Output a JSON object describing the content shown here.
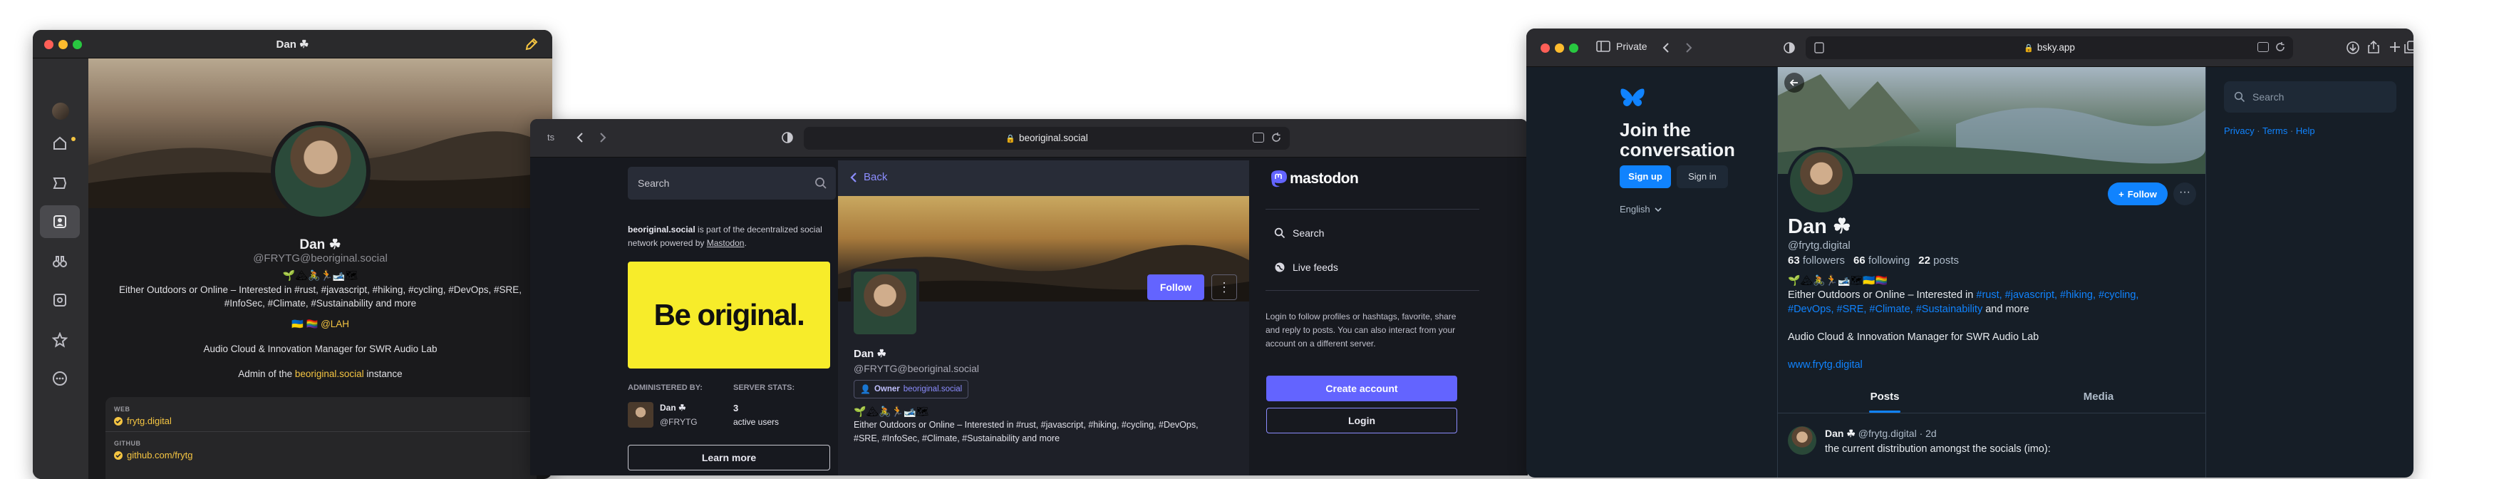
{
  "ivory": {
    "title": "Dan ☘",
    "display_name": "Dan ☘",
    "handle": "@FRYTG@beoriginal.social",
    "bio_emoji": "🌱🏔🚴🏃🎿🗺",
    "bio_line1": "Either Outdoors or Online – Interested in #rust, #javascript, #hiking, #cycling, #DevOps, #SRE,",
    "bio_line2": "#InfoSec, #Climate, #Sustainability and more",
    "bio_flags": "🇺🇦 🏳️‍🌈 @LAH",
    "bio_job": "Audio Cloud & Innovation Manager for SWR Audio Lab",
    "admin_prefix": "Admin of the ",
    "admin_link": "beoriginal.social",
    "admin_suffix": " instance",
    "fields": [
      {
        "label": "WEB",
        "value": "frytg.digital"
      },
      {
        "label": "GITHUB",
        "value": "github.com/frytg"
      }
    ]
  },
  "mastodon": {
    "toolbar_left_text": "ts",
    "url": "beoriginal.social",
    "search_placeholder": "Search",
    "about_strong": "beoriginal.social",
    "about_text": " is part of the decentralized social network powered by ",
    "about_link": "Mastodon",
    "about_end": ".",
    "banner_text": "Be original.",
    "administered_by_label": "ADMINISTERED BY:",
    "server_stats_label": "SERVER STATS:",
    "admin_name": "Dan ☘",
    "admin_handle": "@FRYTG",
    "active_users_count": "3",
    "active_users_label": "active users",
    "learn_more": "Learn more",
    "back_label": "Back",
    "follow_label": "Follow",
    "more_label": "⋮",
    "profile_name": "Dan ☘",
    "profile_handle": "@FRYTG@beoriginal.social",
    "owner_badge": "Owner",
    "owner_badge_domain": "beoriginal.social",
    "bio_emoji": "🌱🏔🚴🏃🎿🗺",
    "bio_line1": "Either Outdoors or Online – Interested in #rust, #javascript, #hiking, #cycling, #DevOps,",
    "bio_line2": "#SRE, #InfoSec, #Climate, #Sustainability and more",
    "logo_text": "mastodon",
    "nav": [
      {
        "icon": "search-icon",
        "label": "Search"
      },
      {
        "icon": "globe-icon",
        "label": "Live feeds"
      }
    ],
    "signup_prompt": "Login to follow profiles or hashtags, favorite, share and reply to posts. You can also interact from your account on a different server.",
    "create_account": "Create account",
    "login": "Login"
  },
  "bluesky": {
    "private_label": "Private",
    "url": "bsky.app",
    "join_title": "Join the conversation",
    "sign_up": "Sign up",
    "sign_in": "Sign in",
    "language": "English",
    "display_name": "Dan ☘",
    "handle": "@frytg.digital",
    "followers_count": "63",
    "followers_label": "followers",
    "following_count": "66",
    "following_label": "following",
    "posts_count": "22",
    "posts_label": "posts",
    "follow_label": "Follow",
    "bio_emoji": "🌱🏔🚴🏃🎿🗺🇺🇦🏳️‍🌈",
    "bio_line1_prefix": "Either Outdoors or Online – Interested in ",
    "bio_line1_tags": "#rust, #javascript, #hiking, #cycling,",
    "bio_line2_tags": "#DevOps, #SRE, #Climate, #Sustainability",
    "bio_line2_suffix": " and more",
    "bio_job": "Audio Cloud & Innovation Manager for SWR Audio Lab",
    "website": "www.frytg.digital",
    "tabs": [
      "Posts",
      "Media"
    ],
    "post_author": "Dan ☘",
    "post_handle": "@frytg.digital · 2d",
    "post_text": "the current distribution amongst the socials (imo):",
    "search_placeholder": "Search",
    "footer_links": [
      "Privacy",
      "Terms",
      "Help"
    ]
  },
  "colors": {
    "ivory_accent": "#f5c542",
    "mastodon_accent": "#6364ff",
    "bluesky_accent": "#1083fe",
    "banner_yellow": "#f7ec2a"
  }
}
